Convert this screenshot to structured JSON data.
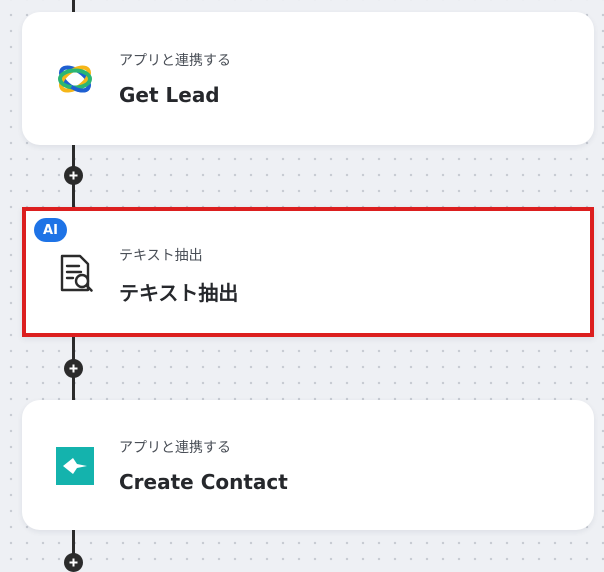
{
  "colors": {
    "canvas_background": "#eef0f4",
    "connector": "#2b2b2b",
    "selection_border": "#dc1f1f",
    "ai_badge": "#1e73e6",
    "create_contact_icon": "#14b3ad"
  },
  "steps": [
    {
      "subtitle": "アプリと連携する",
      "title": "Get Lead",
      "icon": "rings-logo-icon"
    },
    {
      "badge": "AI",
      "subtitle": "テキスト抽出",
      "title": "テキスト抽出",
      "icon": "document-search-icon",
      "selected": true
    },
    {
      "subtitle": "アプリと連携する",
      "title": "Create Contact",
      "icon": "arrow-logo-icon"
    }
  ],
  "add_step_icon": "plus-icon"
}
